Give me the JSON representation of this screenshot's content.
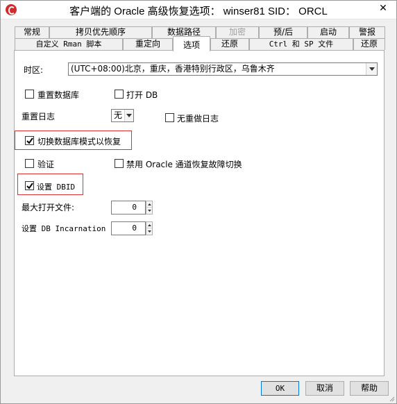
{
  "window": {
    "title": "客户端的 Oracle 高级恢复选项： winser81  SID： ORCL",
    "close_glyph": "✕"
  },
  "tabs_row1": [
    {
      "label": "常规"
    },
    {
      "label": "拷贝优先顺序"
    },
    {
      "label": "数据路径"
    },
    {
      "label": "加密",
      "disabled": true
    },
    {
      "label": "预/后"
    },
    {
      "label": "启动"
    },
    {
      "label": "警报"
    }
  ],
  "tabs_row2": [
    {
      "label": "自定义 Rman 脚本"
    },
    {
      "label": "重定向"
    },
    {
      "label": "选项",
      "active": true
    },
    {
      "label": "还原"
    },
    {
      "label": "Ctrl 和 SP 文件"
    },
    {
      "label": "还原"
    }
  ],
  "options": {
    "timezone_label": "时区:",
    "timezone_value": "(UTC+08:00)北京，重庆，香港特别行政区，乌鲁木齐",
    "reset_database": {
      "label": "重置数据库",
      "checked": false
    },
    "open_db": {
      "label": "打开 DB",
      "checked": false
    },
    "reset_logs_label": "重置日志",
    "reset_logs_value": "无",
    "no_redo_logs": {
      "label": "无重做日志",
      "checked": false
    },
    "switch_db_mode": {
      "label": "切换数据库模式以恢复",
      "checked": true
    },
    "validate": {
      "label": "验证",
      "checked": false
    },
    "disable_failover": {
      "label": "禁用 Oracle 通道恢复故障切换",
      "checked": false
    },
    "set_dbid": {
      "label": "设置 DBID",
      "checked": true
    },
    "max_open_files_label": "最大打开文件:",
    "max_open_files_value": "0",
    "set_incarnation_label": "设置 DB Incarnation",
    "set_incarnation_value": "0"
  },
  "buttons": {
    "ok": "OK",
    "cancel": "取消",
    "help": "帮助"
  },
  "colors": {
    "highlight_box": "#e03030",
    "default_button_border": "#0078d7"
  }
}
